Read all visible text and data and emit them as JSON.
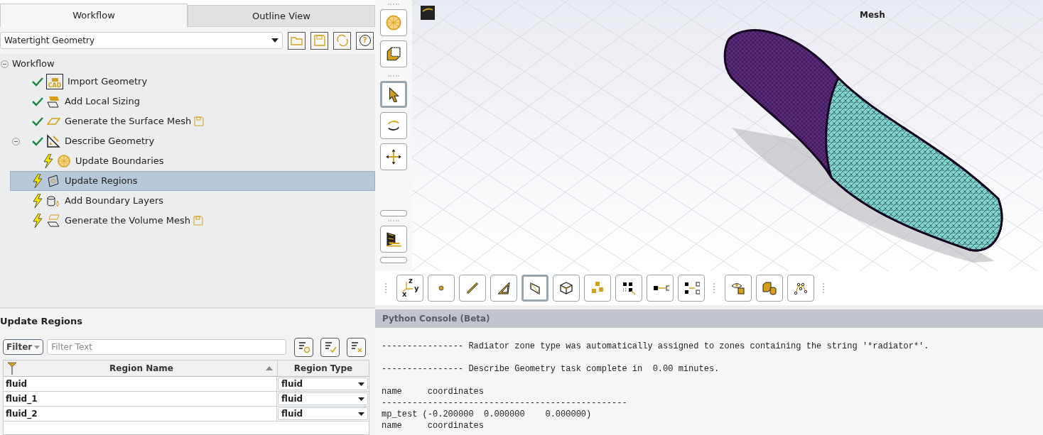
{
  "tabs": [
    {
      "label": "Workflow",
      "selected": true
    },
    {
      "label": "Outline View",
      "selected": false
    }
  ],
  "workflow_select": {
    "value": "Watertight Geometry"
  },
  "help_button": {
    "label": "?"
  },
  "tree": {
    "label": "Workflow",
    "expanded": true,
    "children": [
      {
        "label": "Import Geometry",
        "icon_text": "CAD",
        "done": true,
        "save_marker": false,
        "selected": false
      },
      {
        "label": "Add Local Sizing",
        "done": true,
        "save_marker": false,
        "selected": false
      },
      {
        "label": "Generate the Surface Mesh",
        "done": true,
        "save_marker": true,
        "selected": false
      },
      {
        "label": "Describe Geometry",
        "done": true,
        "save_marker": false,
        "selected": false,
        "expanded": true,
        "children": [
          {
            "label": "Update Boundaries",
            "done": false,
            "save_marker": false,
            "selected": false
          }
        ]
      },
      {
        "label": "Update Regions",
        "done": false,
        "save_marker": false,
        "selected": true
      },
      {
        "label": "Add Boundary Layers",
        "done": false,
        "save_marker": false,
        "selected": false
      },
      {
        "label": "Generate the Volume Mesh",
        "done": false,
        "save_marker": true,
        "selected": false
      }
    ]
  },
  "task_panel": {
    "title": "Update Regions",
    "filter_button": "Filter",
    "filter_field": {
      "placeholder": "Filter Text"
    },
    "table": {
      "columns": [
        "Region Name",
        "Region Type"
      ],
      "rows": [
        {
          "name": "fluid",
          "type": "fluid"
        },
        {
          "name": "fluid_1",
          "type": "fluid"
        },
        {
          "name": "fluid_2",
          "type": "fluid"
        }
      ]
    }
  },
  "side_tools": [
    {
      "selected": false
    },
    {
      "selected": false
    },
    {
      "selected": true
    },
    {
      "selected": false
    },
    {
      "selected": false
    },
    {
      "selected": false
    }
  ],
  "viewport": {
    "title": "Mesh"
  },
  "bottom_tools": [
    {
      "selected": false,
      "axis_labels": [
        "z",
        "y",
        "x"
      ]
    },
    {
      "selected": false
    },
    {
      "selected": false
    },
    {
      "selected": false
    },
    {
      "selected": true
    },
    {
      "selected": false
    },
    {
      "selected": false
    },
    {
      "selected": false
    },
    {
      "selected": false
    },
    {
      "selected": false
    },
    {
      "selected": false
    },
    {
      "selected": false
    },
    {
      "selected": false
    }
  ],
  "console": {
    "title": "Python Console (Beta)",
    "blocks": [
      [
        "---------------- Radiator zone type was automatically assigned to zones containing the string '*radiator*'."
      ],
      [
        "---------------- Describe Geometry task complete in  0.00 minutes."
      ],
      [
        "name     coordinates",
        "------------------------------------------------",
        "mp_test (-0.200000  0.000000    0.000000)",
        "name     coordinates"
      ]
    ]
  }
}
